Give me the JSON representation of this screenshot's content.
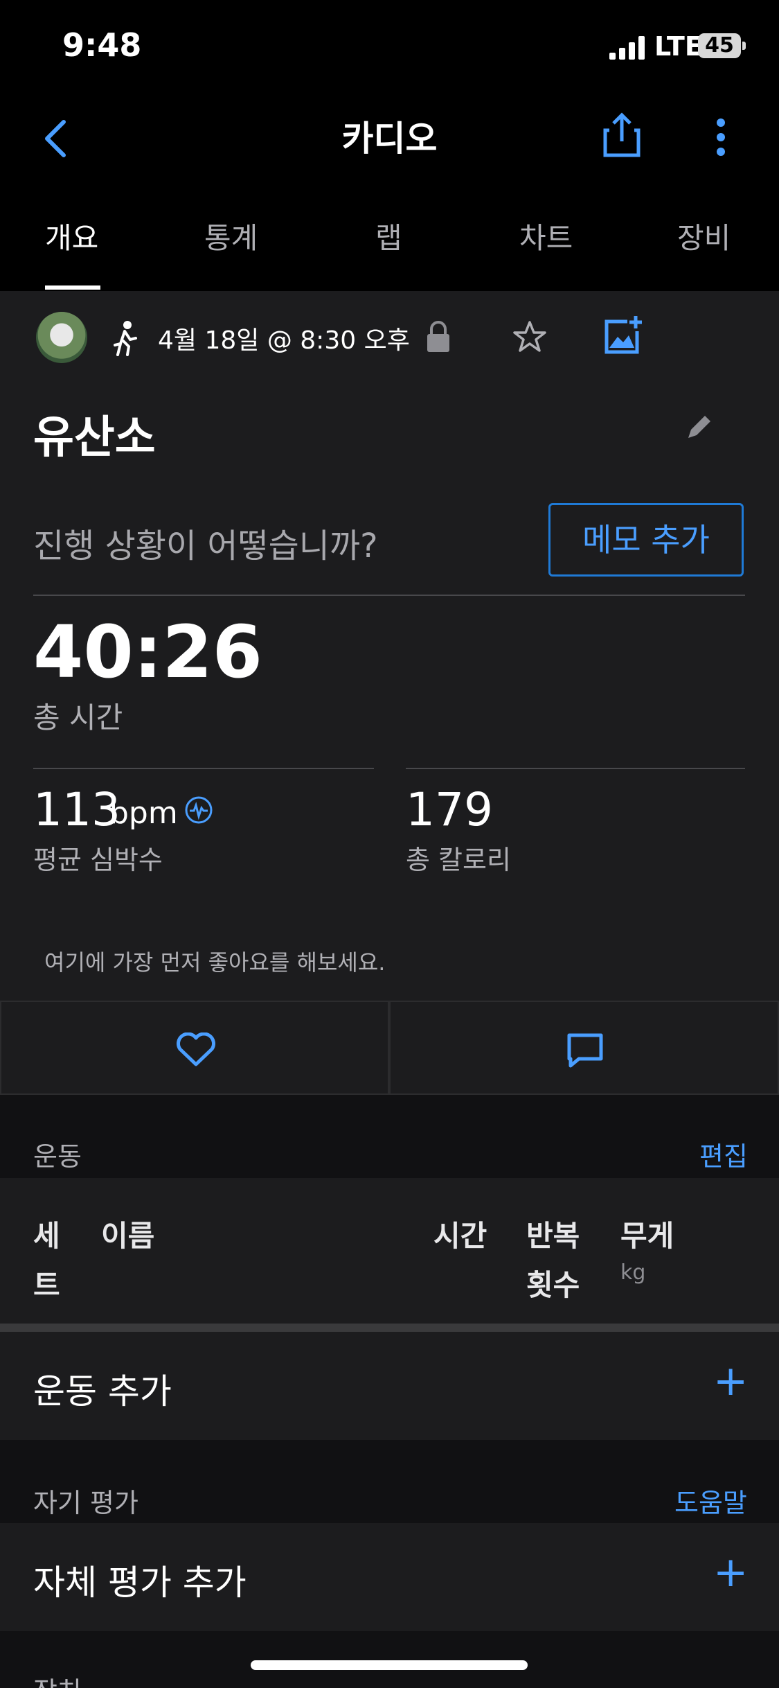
{
  "status": {
    "time": "9:48",
    "network": "LTE",
    "battery": "45"
  },
  "header": {
    "title": "카디오"
  },
  "tabs": [
    {
      "label": "개요",
      "active": true
    },
    {
      "label": "통계"
    },
    {
      "label": "랩"
    },
    {
      "label": "차트"
    },
    {
      "label": "장비"
    }
  ],
  "activity": {
    "date": "4월 18일 @ 8:30 오후",
    "name": "유산소",
    "prompt": "진행 상황이 어떻습니까?",
    "memo_button": "메모 추가",
    "total_time": "40:26",
    "total_time_label": "총 시간",
    "avg_hr_value": "113",
    "avg_hr_unit": "bpm",
    "avg_hr_label": "평균 심박수",
    "calories_value": "179",
    "calories_label": "총 칼로리",
    "like_prompt": "여기에 가장 먼저 좋아요를 해보세요."
  },
  "exercise_section": {
    "title": "운동",
    "edit": "편집",
    "columns": {
      "set_line1": "세",
      "set_line2": "트",
      "name": "이름",
      "time": "시간",
      "reps_line1": "반복",
      "reps_line2": "횟수",
      "weight": "무게",
      "weight_unit": "kg"
    },
    "add_label": "운동 추가"
  },
  "self_eval_section": {
    "title": "자기 평가",
    "help": "도움말",
    "add_label": "자체 평가 추가"
  },
  "next_section": {
    "title": "장치"
  },
  "colors": {
    "accent": "#4a9eff",
    "background": "#1c1c1e",
    "header": "#000000"
  }
}
